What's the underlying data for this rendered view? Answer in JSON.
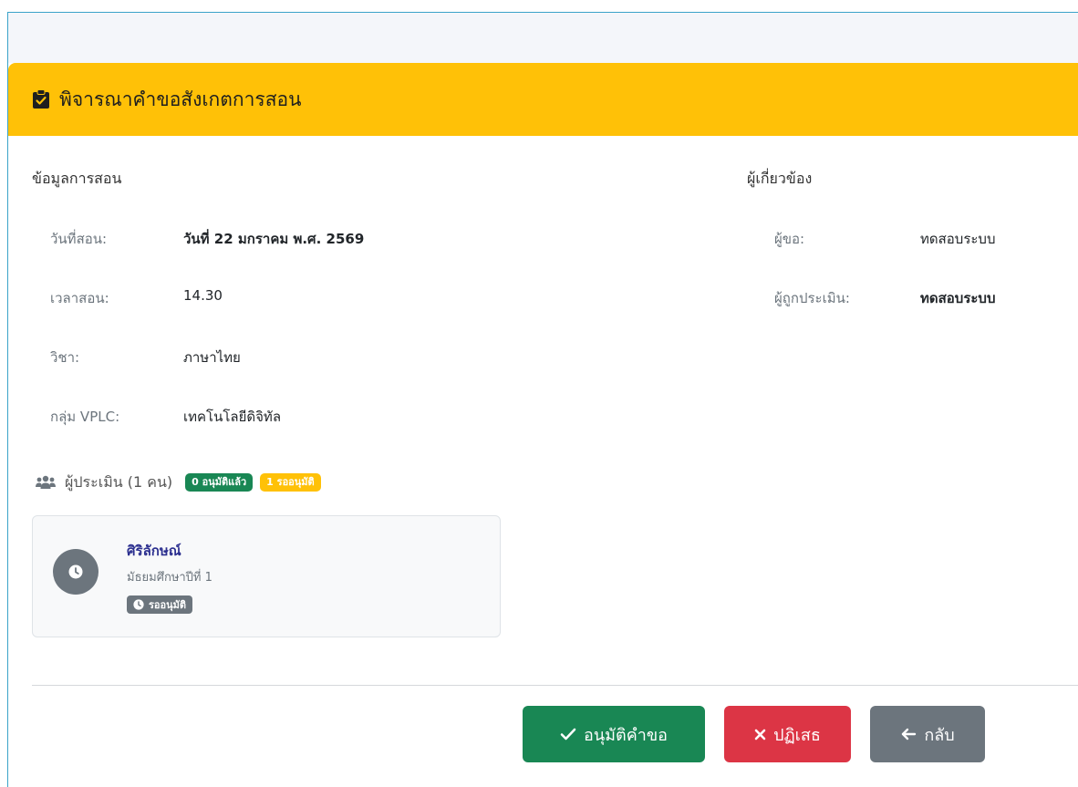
{
  "header": {
    "title": "พิจารณาคำขอสังเกตการสอน",
    "icon": "clipboard-check-icon"
  },
  "teaching_info": {
    "section_title": "ข้อมูลการสอน",
    "rows": [
      {
        "label": "วันที่สอน:",
        "value": "วันที่ 22 มกราคม พ.ศ. 2569"
      },
      {
        "label": "เวลาสอน:",
        "value": "14.30"
      },
      {
        "label": "วิชา:",
        "value": "ภาษาไทย"
      },
      {
        "label": "กลุ่ม VPLC:",
        "value": "เทคโนโลยีดิจิทัล"
      }
    ]
  },
  "related_people": {
    "section_title": "ผู้เกี่ยวข้อง",
    "rows": [
      {
        "label": "ผู้ขอ:",
        "value": "ทดสอบระบบ"
      },
      {
        "label": "ผู้ถูกประเมิน:",
        "value": "ทดสอบระบบ"
      }
    ]
  },
  "evaluators": {
    "title": "ผู้ประเมิน (1 คน)",
    "icon": "users-icon",
    "approved_badge": "0 อนุมัติแล้ว",
    "pending_badge": "1 รออนุมัติ",
    "items": [
      {
        "name": "ศิริลักษณ์",
        "grade": "มัธยมศึกษาปีที่ 1",
        "status": "รออนุมัติ",
        "icon": "clock-icon"
      }
    ]
  },
  "actions": {
    "approve_label": "อนุมัติคำขอ",
    "reject_label": "ปฏิเสธ",
    "back_label": "กลับ"
  },
  "colors": {
    "header_bg": "#ffc107",
    "approve": "#198754",
    "reject": "#dc3545",
    "back": "#6c757d"
  }
}
